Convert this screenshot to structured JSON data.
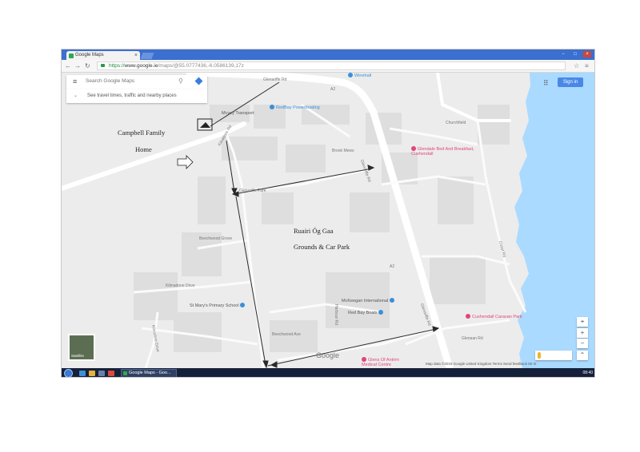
{
  "browser": {
    "tab_title": "Google Maps",
    "tab_close": "×",
    "url_secure": "https://",
    "url_host": "www.google.ie",
    "url_path": "/maps/@55.0777436,-6.0586139,17z",
    "window_buttons": [
      "−",
      "□",
      "×"
    ],
    "nav_icons": [
      "back-icon",
      "forward-icon",
      "reload-icon"
    ]
  },
  "search": {
    "placeholder": "Search Google Maps",
    "traffic_text": "See travel times, traffic and nearby places"
  },
  "header": {
    "sign_in": "Sign in"
  },
  "map": {
    "streets": [
      "Glenariffe Rd",
      "A2",
      "Kilnadore Rd",
      "Brook Mews",
      "Middle Park",
      "Churchfield",
      "Bridge Street",
      "Elmfield Rd",
      "Shore Street",
      "Glenariffe Rd",
      "Cushendall Road",
      "Glenariffe Park",
      "Beechwood Grove",
      "Kilmadone Drive",
      "Braeside Park",
      "Shore Rd",
      "Dunerue Park",
      "Dalriada Ave",
      "Glenariffe Rd",
      "Coast Rd",
      "Kilnadore Drive",
      "Beechwood Ave",
      "Mill St",
      "Gortaclee Rd",
      "Kilnadore Park",
      "Harbour Rd",
      "Church Park",
      "Glenaan Rd"
    ],
    "places": [
      {
        "name": "Winehall",
        "color": "#3a8fd8"
      },
      {
        "name": "Mcvey Transport",
        "color": "#3a8fd8"
      },
      {
        "name": "RedBay Powerboating",
        "color": "#3a8fd8"
      },
      {
        "name": "Glendale Bed And Breakfast, Cushendall",
        "color": "#e0457b"
      },
      {
        "name": "St Mary's Primary School",
        "color": "#3a8fd8"
      },
      {
        "name": "McKeegan International",
        "color": "#3a8fd8"
      },
      {
        "name": "Red Bay Boats",
        "color": "#3a8fd8"
      },
      {
        "name": "Cushendall Caravan Park",
        "color": "#e0457b"
      },
      {
        "name": "Glens Of Antrim Medical Centre",
        "color": "#e0457b"
      }
    ],
    "satellite_label": "Satellite",
    "google_logo": "Google",
    "attribution": "Map data ©2019 Google   United Kingdom   Terms   Send feedback   50 m",
    "zoom_in": "+",
    "zoom_out": "−",
    "compass": "⌃",
    "sea_color": "#aadaff"
  },
  "annotations": {
    "home_label_line1": "Campbell Family",
    "home_label_line2": "Home",
    "grounds_line1": "Ruairi Óg Gaa",
    "grounds_line2": "Grounds & Car Park"
  },
  "taskbar": {
    "item_label": "Google Maps - Goo...",
    "tray_time": "08:40"
  }
}
